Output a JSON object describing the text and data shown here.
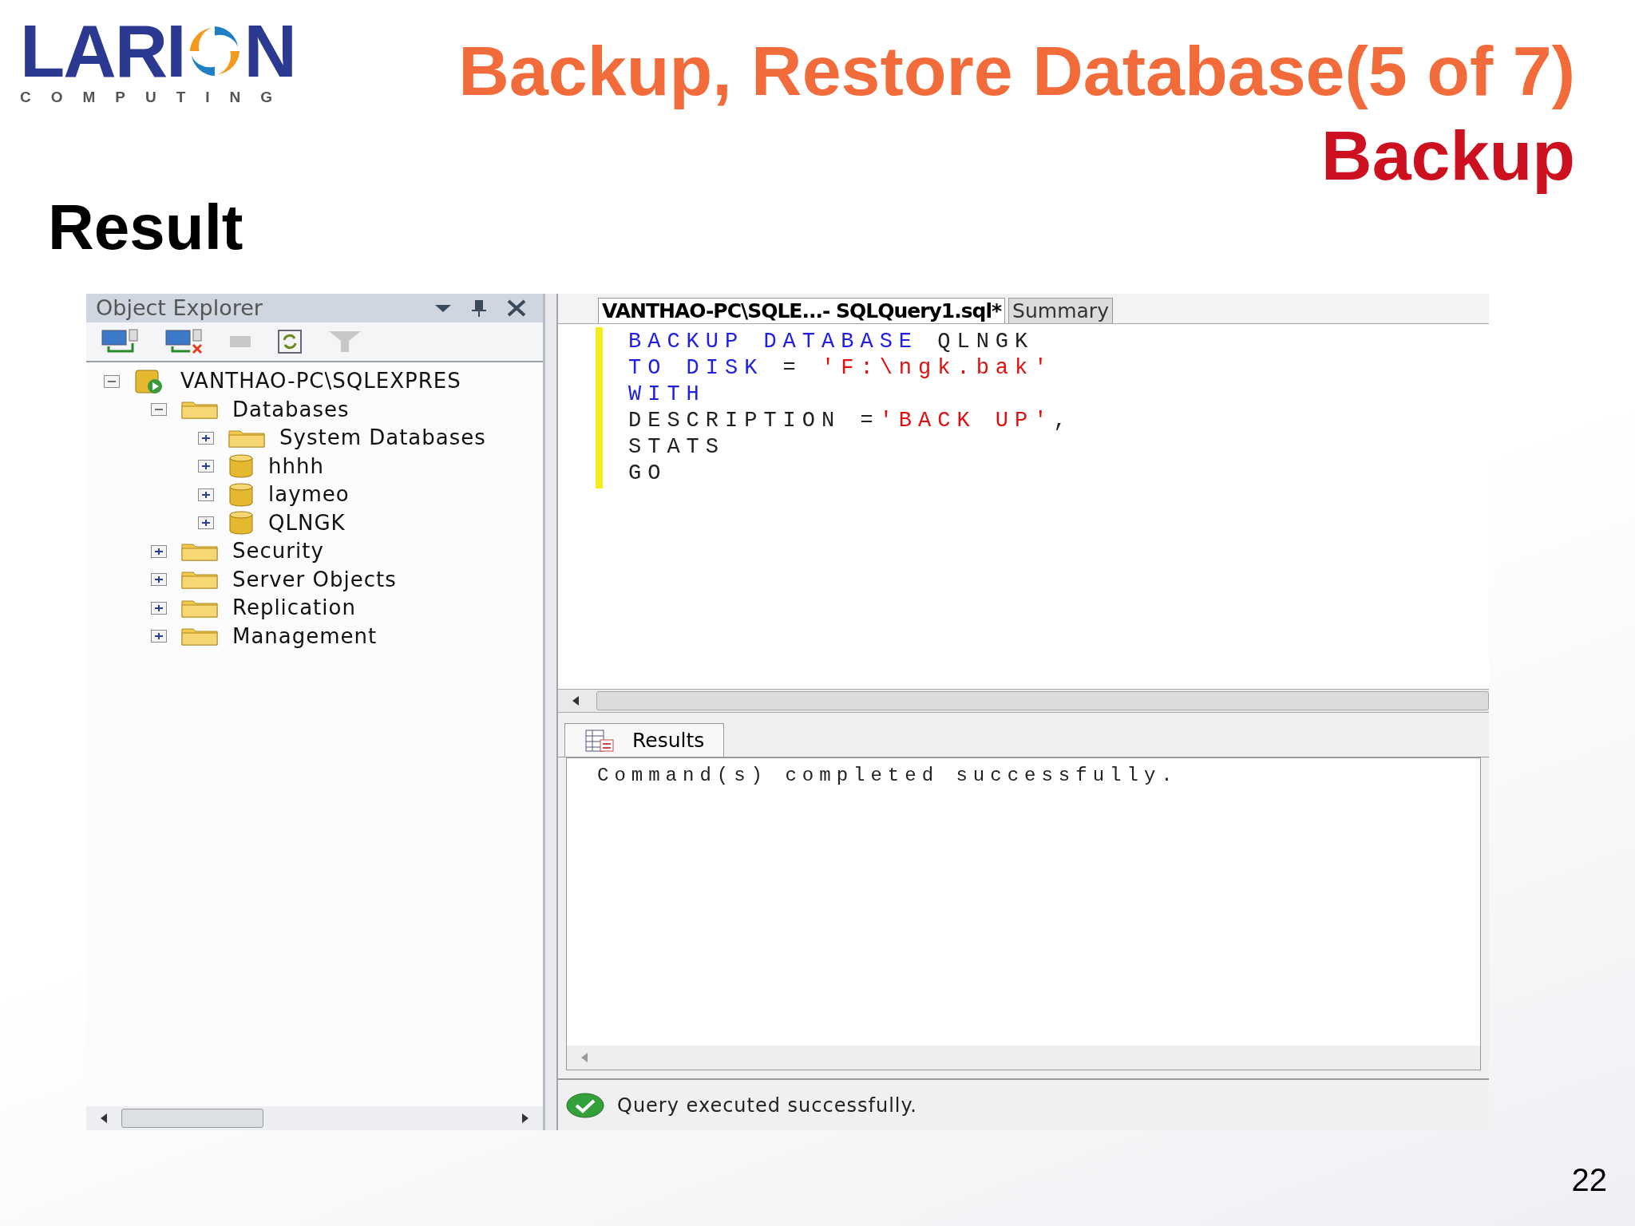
{
  "logo": {
    "left": "LARI",
    "right": "N",
    "tagline": "COMPUTING"
  },
  "title": {
    "line_1": "Backup, Restore Database(5 of 7)",
    "line_2": "Backup"
  },
  "heading": "Result",
  "object_explorer": {
    "title": "Object Explorer",
    "tree": [
      {
        "label": "VANTHAO-PC\\SQLEXPRES",
        "kind": "server",
        "expanded": true,
        "children": [
          {
            "label": "Databases",
            "kind": "folder",
            "expanded": true,
            "children": [
              {
                "label": "System Databases",
                "kind": "folder",
                "expanded": false
              },
              {
                "label": "hhhh",
                "kind": "database",
                "expanded": false
              },
              {
                "label": "laymeo",
                "kind": "database",
                "expanded": false
              },
              {
                "label": "QLNGK",
                "kind": "database",
                "expanded": false
              }
            ]
          },
          {
            "label": "Security",
            "kind": "folder",
            "expanded": false
          },
          {
            "label": "Server Objects",
            "kind": "folder",
            "expanded": false
          },
          {
            "label": "Replication",
            "kind": "folder",
            "expanded": false
          },
          {
            "label": "Management",
            "kind": "folder",
            "expanded": false
          }
        ]
      }
    ]
  },
  "editor": {
    "tabs": [
      {
        "label": "VANTHAO-PC\\SQLE...- SQLQuery1.sql*",
        "selected": true
      },
      {
        "label": "Summary",
        "selected": false
      }
    ],
    "lines": [
      [
        {
          "text": "BACKUP DATABASE",
          "kind": "keyword"
        },
        {
          "text": " QLNGK",
          "kind": "plain"
        }
      ],
      [
        {
          "text": "TO DISK",
          "kind": "keyword"
        },
        {
          "text": " = ",
          "kind": "plain"
        },
        {
          "text": "'F:\\ngk.bak'",
          "kind": "string"
        }
      ],
      [
        {
          "text": "WITH",
          "kind": "keyword"
        }
      ],
      [
        {
          "text": "DESCRIPTION =",
          "kind": "plain"
        },
        {
          "text": "'BACK UP'",
          "kind": "string"
        },
        {
          "text": ",",
          "kind": "plain"
        }
      ],
      [
        {
          "text": "STATS",
          "kind": "plain"
        }
      ],
      [
        {
          "text": "GO",
          "kind": "plain"
        }
      ]
    ]
  },
  "results": {
    "tab": "Results",
    "message": "Command(s) completed successfully."
  },
  "status_bar": "Query executed successfully.",
  "page_number": "22"
}
